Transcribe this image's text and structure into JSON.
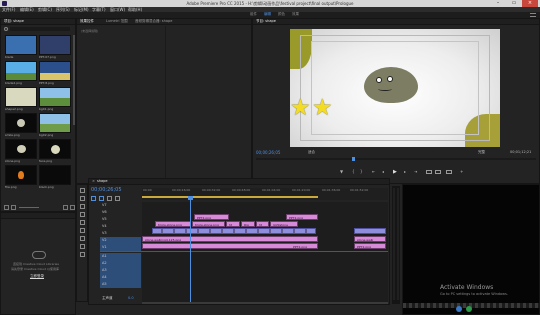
{
  "window": {
    "title": "Adobe Premiere Pro CC 2015 - H:\\剪辑\\动画作品\\festival project\\final output\\Prologue"
  },
  "menu": {
    "items": [
      "文件(F)",
      "编辑(E)",
      "剪辑(C)",
      "序列(S)",
      "标记(M)",
      "字幕(T)",
      "窗口(W)",
      "帮助(H)"
    ]
  },
  "workspace": {
    "tabs": [
      "组件",
      "编辑",
      "颜色",
      "效果"
    ],
    "active_index": 1
  },
  "project_panel": {
    "tab_label": "项目: shape",
    "items": [
      {
        "label": "blade",
        "color": "#3a6fb0"
      },
      {
        "label": "PPT-07.png",
        "color": "#2f3f6a"
      },
      {
        "label": "blade2.png",
        "color": "#4aa0d8"
      },
      {
        "label": "PPT-8.png",
        "color": "#2b4f8a"
      },
      {
        "label": "shape2.png",
        "color": "#d9d9c0"
      },
      {
        "label": "bg01.png",
        "color": "#5d8e3c"
      },
      {
        "label": "smile.png",
        "color": "#0a0a0a"
      },
      {
        "label": "bg02.png",
        "color": "#6e9c48"
      },
      {
        "label": "stone.png",
        "color": "#0a0a0a"
      },
      {
        "label": "face.png",
        "color": "#0a0a0a"
      },
      {
        "label": "fire.png",
        "color": "#0a0a0a"
      },
      {
        "label": "black.png",
        "color": "#0a0a0a"
      }
    ],
    "cloud_message_1": "连接到 Creative Cloud Libraries",
    "cloud_message_2": "请先登录 Creative Cloud 以使用库",
    "cloud_button": "立即登录"
  },
  "source_panel": {
    "tabs": [
      "效果控件",
      "Lumetri 范围",
      "音频剪辑混合器: shape"
    ],
    "active_index": 0,
    "no_clip_text": "(未选择剪辑)"
  },
  "program_monitor": {
    "tab_label": "节目: shape",
    "timecode_left": "00;00;26;05",
    "fit_label": "适合",
    "quality_label": "完整",
    "timecode_right": "00;01;12;21"
  },
  "timeline": {
    "tab_label": "shape",
    "timecode": "00;00;26;05",
    "ruler_labels": [
      "00;00",
      "00;00;16;00",
      "00;00;32;00",
      "00;00;48;00",
      "00;01;04;00",
      "00;01;20;00",
      "00;01;36;00",
      "00;01;52;00",
      "00;02;08;00"
    ],
    "video_tracks": [
      "V7",
      "V6",
      "V5",
      "V4",
      "V3",
      "V2",
      "V1"
    ],
    "audio_tracks": [
      "A1",
      "A2",
      "A3",
      "A4",
      "A5"
    ],
    "master_label": "主声道",
    "master_value": "0.0",
    "clips": {
      "c1": "PPT2.png",
      "c2": "PPT2.png",
      "c3": "triple-stone.png",
      "c4": "ht",
      "c5": "Rig",
      "c6": "ht",
      "c7": "lightstone",
      "c8": "stone-walking4.125.png",
      "c9": "PPT2.png",
      "c10": "stone-walk",
      "c11": "PPT2.png"
    }
  },
  "watermark": {
    "line1": "Activate Windows",
    "line2": "Go to PC settings to activate Windows."
  }
}
